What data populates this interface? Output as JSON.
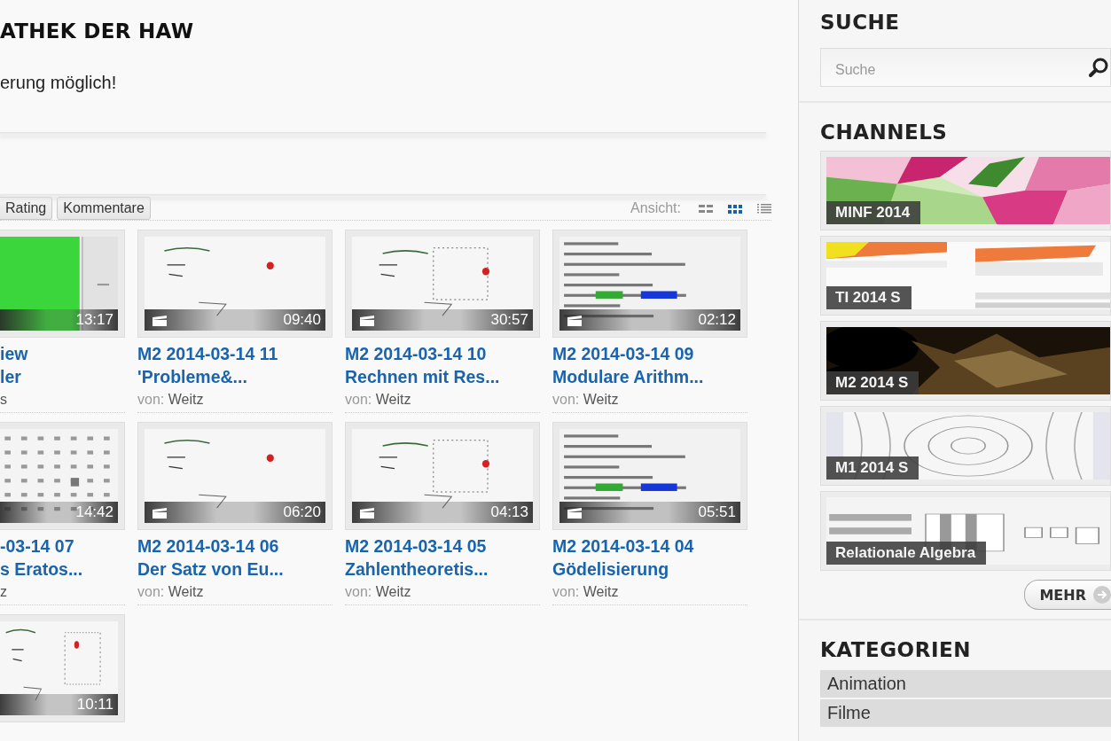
{
  "header": {
    "title": "ATHEK DER HAW",
    "notice": "erung möglich!"
  },
  "toolbar": {
    "sort_buttons": [
      {
        "label": "Rating"
      },
      {
        "label": "Kommentare"
      }
    ],
    "view_label": "Ansicht:",
    "views": [
      {
        "selected": false
      },
      {
        "selected": true
      },
      {
        "selected": false
      }
    ]
  },
  "videos": [
    {
      "kind": "cut",
      "duration": "13:17",
      "title_lines": [
        "iew",
        "ler"
      ],
      "author": "s"
    },
    {
      "kind": "full",
      "duration": "09:40",
      "title_lines": [
        "M2 2014-03-14 11",
        "'Probleme&..."
      ],
      "by_label": "von:",
      "author": "Weitz"
    },
    {
      "kind": "full",
      "duration": "30:57",
      "title_lines": [
        "M2 2014-03-14 10",
        "Rechnen mit Res..."
      ],
      "by_label": "von:",
      "author": "Weitz"
    },
    {
      "kind": "full",
      "duration": "02:12",
      "title_lines": [
        "M2 2014-03-14 09",
        "Modulare Arithm..."
      ],
      "by_label": "von:",
      "author": "Weitz"
    },
    {
      "kind": "cut",
      "duration": "14:42",
      "title_lines": [
        "-03-14 07",
        "s Eratos..."
      ],
      "author": "z"
    },
    {
      "kind": "full",
      "duration": "06:20",
      "title_lines": [
        "M2 2014-03-14 06",
        "Der Satz von Eu..."
      ],
      "by_label": "von:",
      "author": "Weitz"
    },
    {
      "kind": "full",
      "duration": "04:13",
      "title_lines": [
        "M2 2014-03-14 05",
        "Zahlentheoretis..."
      ],
      "by_label": "von:",
      "author": "Weitz"
    },
    {
      "kind": "full",
      "duration": "05:51",
      "title_lines": [
        "M2 2014-03-14 04",
        "Gödelisierung"
      ],
      "by_label": "von:",
      "author": "Weitz"
    },
    {
      "kind": "cut",
      "duration": "10:11"
    }
  ],
  "sidebar": {
    "search_heading": "SUCHE",
    "search": {
      "placeholder": "Suche"
    },
    "channels_heading": "CHANNELS",
    "channels": [
      {
        "label": "MINF 2014"
      },
      {
        "label": "TI 2014 S"
      },
      {
        "label": "M2 2014 S"
      },
      {
        "label": "M1 2014 S"
      },
      {
        "label": "Relationale Algebra"
      }
    ],
    "more_button": "MEHR",
    "categories_heading": "KATEGORIEN",
    "categories": [
      {
        "label": "Animation"
      },
      {
        "label": "Filme"
      }
    ]
  }
}
